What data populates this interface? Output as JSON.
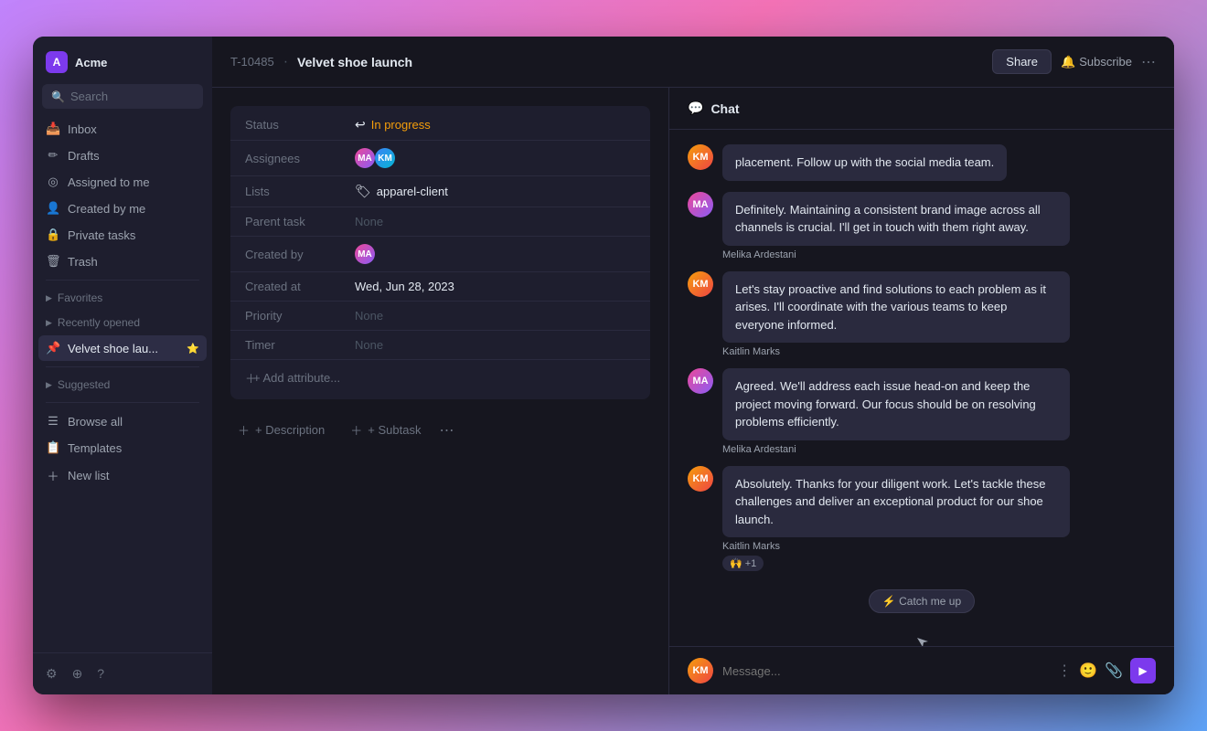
{
  "app": {
    "workspace": {
      "name": "Acme",
      "initial": "A"
    }
  },
  "sidebar": {
    "search_label": "Search",
    "nav_items": [
      {
        "id": "inbox",
        "label": "Inbox",
        "icon": "inbox"
      },
      {
        "id": "drafts",
        "label": "Drafts",
        "icon": "pencil"
      },
      {
        "id": "assigned",
        "label": "Assigned to me",
        "icon": "circle"
      },
      {
        "id": "created",
        "label": "Created by me",
        "icon": "person"
      },
      {
        "id": "private",
        "label": "Private tasks",
        "icon": "lock"
      },
      {
        "id": "trash",
        "label": "Trash",
        "icon": "trash"
      }
    ],
    "sections": [
      {
        "id": "favorites",
        "label": "Favorites"
      },
      {
        "id": "recently_opened",
        "label": "Recently opened"
      }
    ],
    "active_item": {
      "label": "Velvet shoe lau...",
      "icon": "📌"
    },
    "suggested_label": "Suggested",
    "browse_all_label": "Browse all",
    "templates_label": "Templates",
    "new_list_label": "New list",
    "bottom_icons": [
      "settings",
      "plus",
      "question"
    ]
  },
  "header": {
    "task_id": "T-10485",
    "task_title": "Velvet shoe launch",
    "share_label": "Share",
    "subscribe_label": "Subscribe"
  },
  "task": {
    "fields": {
      "status_label": "Status",
      "status_value": "In progress",
      "assignees_label": "Assignees",
      "lists_label": "Lists",
      "lists_value": "apparel-client",
      "parent_task_label": "Parent task",
      "parent_task_value": "None",
      "created_by_label": "Created by",
      "created_at_label": "Created at",
      "created_at_value": "Wed, Jun 28, 2023",
      "priority_label": "Priority",
      "priority_value": "None",
      "timer_label": "Timer",
      "timer_value": "None"
    },
    "add_attribute_label": "+ Add attribute...",
    "actions": {
      "description_label": "+ Description",
      "subtask_label": "+ Subtask"
    }
  },
  "chat": {
    "title": "Chat",
    "messages": [
      {
        "sender": "",
        "avatar_initials": "KM",
        "avatar_type": "av1",
        "text": "placement. Follow up with the social media team.",
        "sender_name": ""
      },
      {
        "sender": "Melika Ardestani",
        "avatar_initials": "MA",
        "avatar_type": "av2",
        "text": "Definitely. Maintaining a consistent brand image across all channels is crucial. I'll get in touch with them right away.",
        "sender_name": "Melika Ardestani"
      },
      {
        "sender": "Kaitlin Marks",
        "avatar_initials": "KM",
        "avatar_type": "av1",
        "text": "Let's stay proactive and find solutions to each problem as it arises. I'll coordinate with the various teams to keep everyone informed.",
        "sender_name": "Kaitlin Marks"
      },
      {
        "sender": "Melika Ardestani",
        "avatar_initials": "MA",
        "avatar_type": "av2",
        "text": "Agreed. We'll address each issue head-on and keep the project moving forward. Our focus should be on resolving problems efficiently.",
        "sender_name": "Melika Ardestani"
      },
      {
        "sender": "Kaitlin Marks",
        "avatar_initials": "KM",
        "avatar_type": "av1",
        "text": "Absolutely. Thanks for your diligent work. Let's tackle these challenges and deliver an exceptional product for our shoe launch.",
        "sender_name": "Kaitlin Marks",
        "has_reaction": true,
        "reaction_emoji": "🙌",
        "reaction_count": "+1"
      }
    ],
    "catch_me_up_label": "⚡ Catch me up",
    "input_placeholder": "Message...",
    "input_avatar_initials": "KM"
  },
  "icons": {
    "inbox": "📥",
    "pencil": "✏",
    "circle": "◎",
    "person": "👤",
    "lock": "🔒",
    "trash": "🗑",
    "settings": "⚙",
    "plus": "＋",
    "question": "?"
  }
}
